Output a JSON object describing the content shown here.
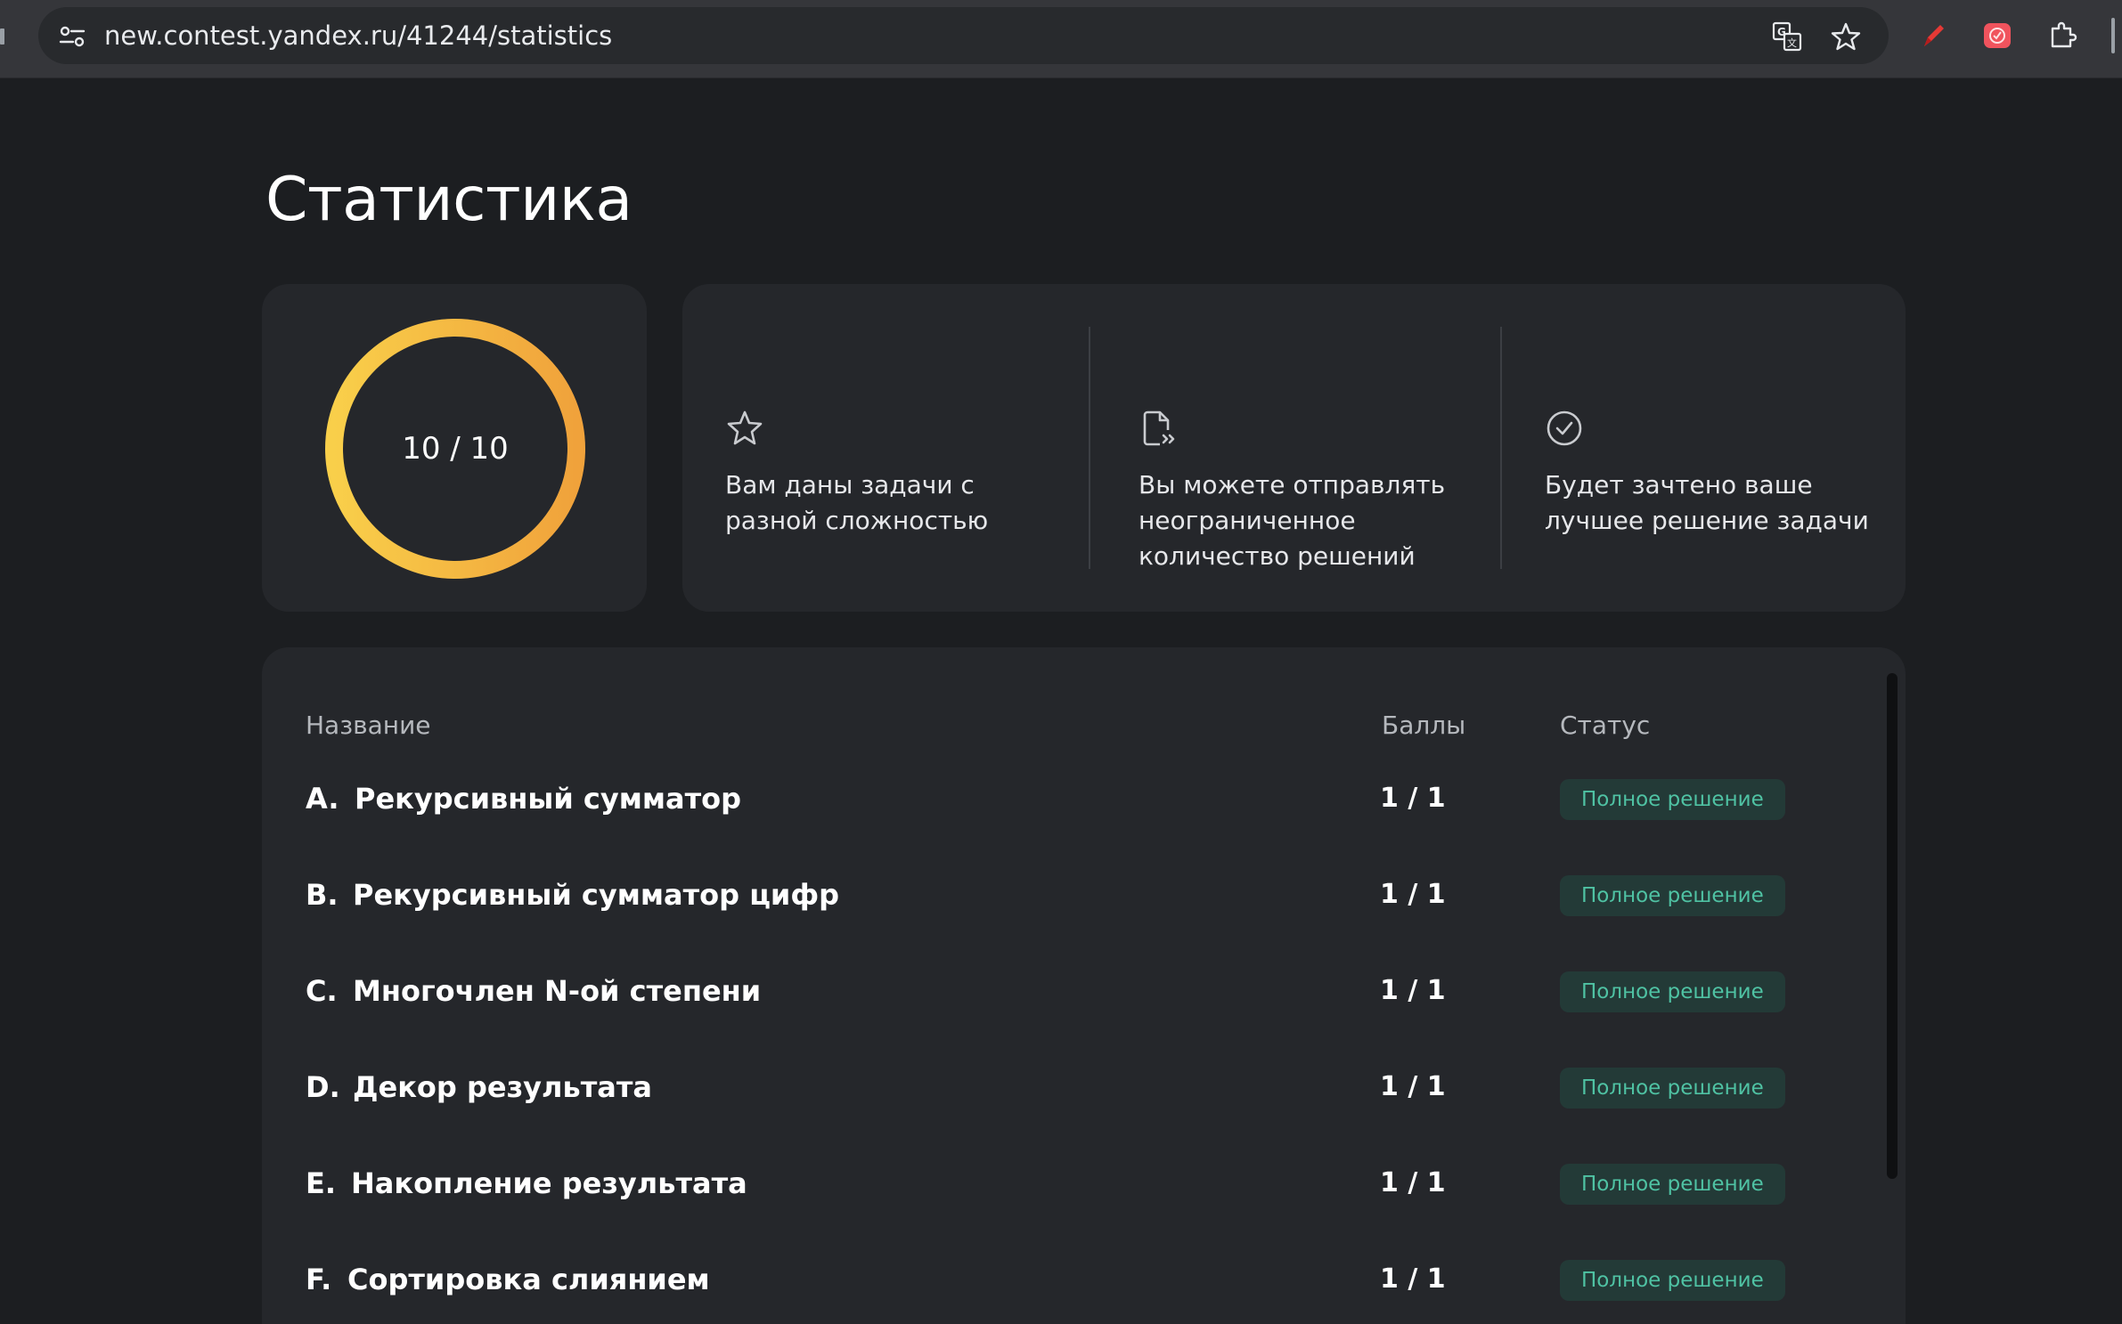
{
  "browser": {
    "url": "new.contest.yandex.ru/41244/statistics"
  },
  "page": {
    "title": "Статистика"
  },
  "score": {
    "label": "10 / 10",
    "progress": 1.0
  },
  "info": [
    {
      "icon": "star-icon",
      "text": "Вам даны задачи с разной сложностью"
    },
    {
      "icon": "document-send-icon",
      "text": "Вы можете отправлять неограниченное количество решений"
    },
    {
      "icon": "check-circle-icon",
      "text": "Будет зачтено ваше лучшее решение задачи"
    }
  ],
  "table": {
    "headers": {
      "name": "Название",
      "score": "Баллы",
      "status": "Статус"
    },
    "rows": [
      {
        "letter": "A.",
        "name": "Рекурсивный сумматор",
        "score": "1 / 1",
        "status": "Полное решение"
      },
      {
        "letter": "B.",
        "name": "Рекурсивный сумматор цифр",
        "score": "1 / 1",
        "status": "Полное решение"
      },
      {
        "letter": "C.",
        "name": "Многочлен N-ой степени",
        "score": "1 / 1",
        "status": "Полное решение"
      },
      {
        "letter": "D.",
        "name": "Декор результата",
        "score": "1 / 1",
        "status": "Полное решение"
      },
      {
        "letter": "E.",
        "name": "Накопление результата",
        "score": "1 / 1",
        "status": "Полное решение"
      },
      {
        "letter": "F.",
        "name": "Сортировка слиянием",
        "score": "1 / 1",
        "status": "Полное решение"
      }
    ]
  },
  "colors": {
    "ring_start": "#f9cf4a",
    "ring_end": "#f0a23b",
    "badge_bg": "#233a37",
    "badge_text": "#4fc2a3"
  }
}
